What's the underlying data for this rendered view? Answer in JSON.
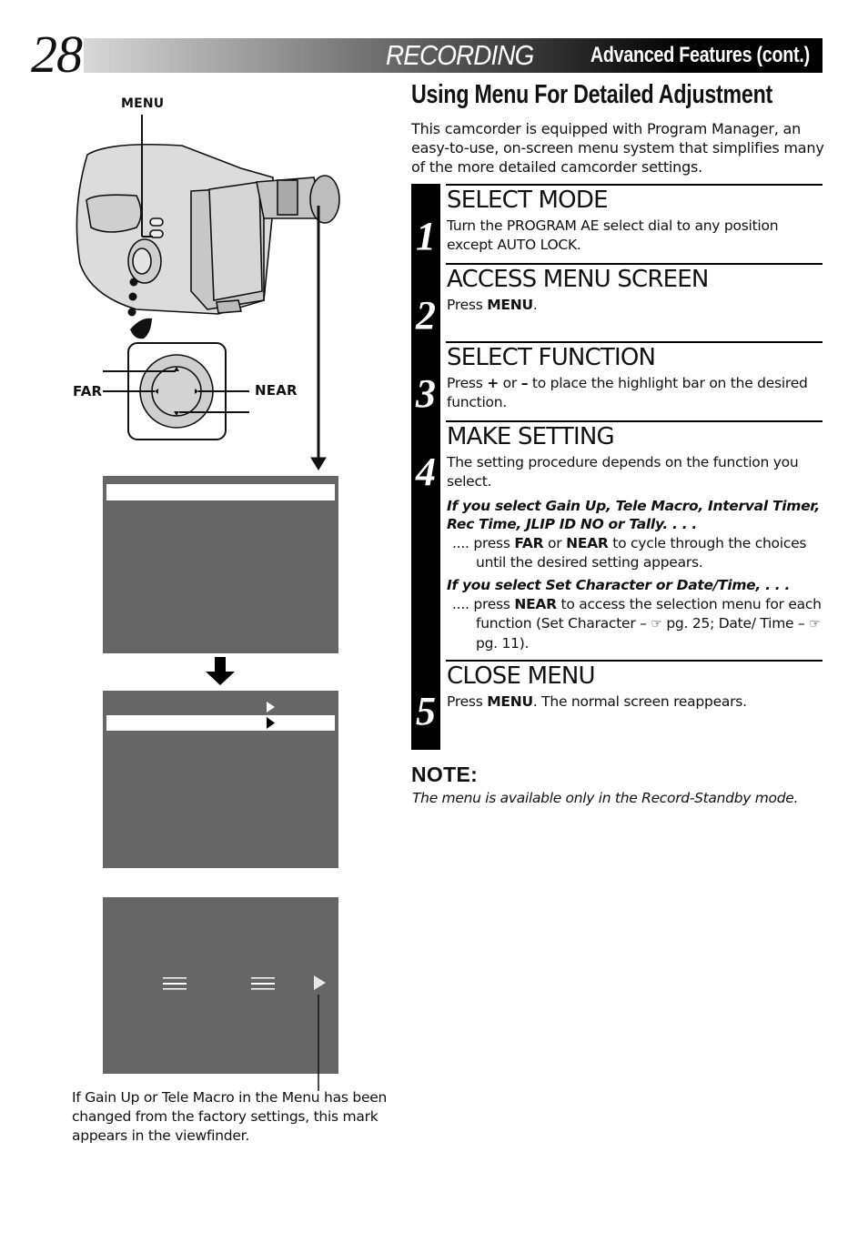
{
  "header": {
    "page_number": "28",
    "title_main": "RECORDING",
    "title_sub": "Advanced Features (cont.)"
  },
  "section": {
    "title": "Using Menu For Detailed Adjustment",
    "intro": "This camcorder is equipped with Program Manager, an easy-to-use, on-screen menu system that simplifies many of the more detailed camcorder settings."
  },
  "steps": [
    {
      "number": "1",
      "title": "SELECT MODE",
      "text": "Turn the PROGRAM AE select dial to any position except AUTO LOCK."
    },
    {
      "number": "2",
      "title": "ACCESS MENU SCREEN",
      "text_prefix": "Press ",
      "text_bold": "MENU",
      "text_suffix": "."
    },
    {
      "number": "3",
      "title": "SELECT FUNCTION",
      "text_prefix": "Press ",
      "text_bold1": "+",
      "text_mid": " or ",
      "text_bold2": "–",
      "text_suffix": " to place the highlight bar on the desired function."
    },
    {
      "number": "4",
      "title": "MAKE SETTING",
      "text": "The setting procedure depends on the function you select.",
      "case1_heading": "If you select Gain Up, Tele Macro, Interval Timer, Rec Time, JLIP ID NO or Tally. . . .",
      "case1_lead": ".... press ",
      "case1_bold1": "FAR",
      "case1_mid": " or ",
      "case1_bold2": "NEAR",
      "case1_rest": " to cycle through the choices until the desired setting appears.",
      "case2_heading": "If you select Set Character or Date/Time, . . .",
      "case2_lead": ".... press ",
      "case2_bold": "NEAR",
      "case2_rest1": " to access the selection menu for each function (Set Character – ",
      "case2_ref1": "pg. 25; Date/ Time – ",
      "case2_ref2": "pg. 11)."
    },
    {
      "number": "5",
      "title": "CLOSE MENU",
      "text_prefix": "Press ",
      "text_bold": "MENU",
      "text_suffix": ". The normal screen reappears."
    }
  ],
  "note": {
    "heading": "NOTE:",
    "text": "The menu is available only in the Record-Standby mode."
  },
  "illustration": {
    "menu_label": "MENU",
    "far_label": "FAR",
    "near_label": "NEAR",
    "reference_icon": "pointing-hand-icon",
    "caption": "If Gain Up or Tele Macro in the Menu has been changed from the factory settings, this mark appears in the viewfinder."
  },
  "colors": {
    "screen_gray": "#666666",
    "highlight": "#ffffff",
    "step_bar": "#000000"
  }
}
